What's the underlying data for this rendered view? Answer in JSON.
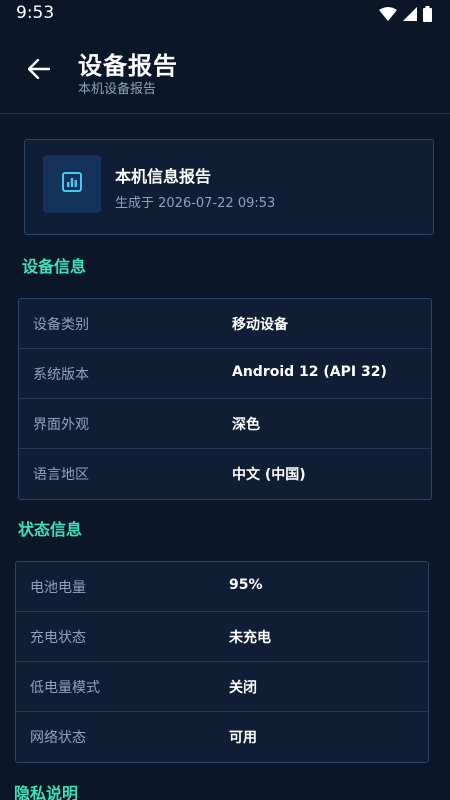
{
  "status_bar": {
    "time": "9:53",
    "icons": [
      "wifi-icon",
      "signal-icon",
      "battery-icon"
    ]
  },
  "header": {
    "title": "设备报告",
    "subtitle": "本机设备报告",
    "back_icon": "back-arrow-icon"
  },
  "report_card": {
    "icon": "chart-icon",
    "title": "本机信息报告",
    "generated": "生成于 2026-07-22 09:53"
  },
  "device_section": {
    "title": "设备信息",
    "rows": [
      {
        "label": "设备类别",
        "value": "移动设备"
      },
      {
        "label": "系统版本",
        "value": "Android 12 (API 32)"
      },
      {
        "label": "界面外观",
        "value": "深色"
      },
      {
        "label": "语言地区",
        "value": "中文 (中国)"
      }
    ]
  },
  "status_section": {
    "title": "状态信息",
    "rows": [
      {
        "label": "电池电量",
        "value": "95%"
      },
      {
        "label": "充电状态",
        "value": "未充电"
      },
      {
        "label": "低电量模式",
        "value": "关闭"
      },
      {
        "label": "网络状态",
        "value": "可用"
      }
    ]
  },
  "privacy_section": {
    "title": "隐私说明"
  },
  "colors": {
    "background": "#0b1729",
    "card": "#0f1e35",
    "border": "#2a4566",
    "accent": "#3ee0b8",
    "muted_text": "#8ea3bb"
  }
}
